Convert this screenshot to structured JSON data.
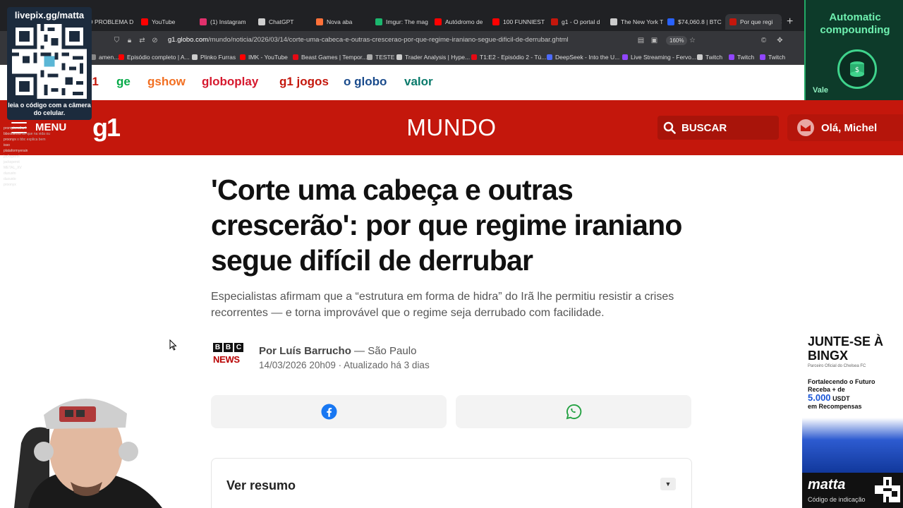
{
  "browser": {
    "tabs": [
      {
        "label": "O PROBLEMA D",
        "color": "#e53935"
      },
      {
        "label": "YouTube",
        "color": "#ff0000"
      },
      {
        "label": "(1) Instagram",
        "color": "#e1306c"
      },
      {
        "label": "ChatGPT",
        "color": "#cfcfcf"
      },
      {
        "label": "Nova aba",
        "color": "#ff7139"
      },
      {
        "label": "Imgur: The mag",
        "color": "#1bb76e"
      },
      {
        "label": "Autódromo de",
        "color": "#ff0000"
      },
      {
        "label": "100 FUNNIEST",
        "color": "#ff0000"
      },
      {
        "label": "g1 - O portal d",
        "color": "#c4170c"
      },
      {
        "label": "The New York T",
        "color": "#cccccc"
      },
      {
        "label": "$74,060.8 | BTC",
        "color": "#2962ff"
      },
      {
        "label": "Por que regi",
        "color": "#c4170c"
      }
    ],
    "url_host": "g1.globo.com",
    "url_path": "/mundo/noticia/2026/03/14/corte-uma-cabeca-e-outras-crescerao-por-que-regime-iraniano-segue-dificil-de-derrubar.ghtml",
    "zoom": "160%",
    "bookmarks": [
      {
        "label": "amen...",
        "color": "#888888"
      },
      {
        "label": "Episódio completo | A...",
        "color": "#ff0000"
      },
      {
        "label": "Plinko Furras",
        "color": "#cccccc"
      },
      {
        "label": "IMK - YouTube",
        "color": "#ff0000"
      },
      {
        "label": "Beast Games | Tempor...",
        "color": "#e50914"
      },
      {
        "label": "TESTE",
        "color": "#aaaaaa"
      },
      {
        "label": "Trader Analysis | Hype...",
        "color": "#cccccc"
      },
      {
        "label": "T1:E2 - Episódio 2 - Tú...",
        "color": "#e50914"
      },
      {
        "label": "DeepSeek - Into the U...",
        "color": "#4d6bfe"
      },
      {
        "label": "Live Streaming - Fervo...",
        "color": "#9146ff"
      },
      {
        "label": "Twitch",
        "color": "#cccccc"
      },
      {
        "label": "Twitch",
        "color": "#9146ff"
      },
      {
        "label": "Twitch",
        "color": "#9146ff"
      }
    ]
  },
  "globo_nav": [
    {
      "label": "g1",
      "color": "#c4170c"
    },
    {
      "label": "ge",
      "color": "#06aa48"
    },
    {
      "label": "gshow",
      "color": "#f26f21"
    },
    {
      "label": "globoplay",
      "color": "#d6192e"
    },
    {
      "label": "g1 jogos",
      "color": "#c4170c"
    },
    {
      "label": "o globo",
      "color": "#1a4b8c"
    },
    {
      "label": "valor",
      "color": "#0a7a6b"
    }
  ],
  "header": {
    "menu": "MENU",
    "logo": "g1",
    "section": "MUNDO",
    "search": "BUSCAR",
    "greeting": "Olá, Michel"
  },
  "article": {
    "headline": "'Corte uma cabeça e outras crescerão': por que regime iraniano segue difícil de derrubar",
    "subtitle": "Especialistas afirmam que a “estrutura em forma de hidra” do Irã lhe permitiu resistir a crises recorrentes — e torna improvável que o regime seja derrubado com facilidade.",
    "source_letters": [
      "B",
      "B",
      "C"
    ],
    "source_news": "NEWS",
    "author": "Por Luís Barrucho",
    "location": "— São Paulo",
    "date": "14/03/2026 20h09 · Atualizado há 3 dias",
    "resumo": "Ver resumo"
  },
  "overlays": {
    "qr_title": "livepix.gg/matta",
    "qr_caption": "leia o código com a câmera do celular.",
    "auto_title": "Automatic compounding",
    "auto_vale": "Vale",
    "bingx_title": "JUNTE-SE À BINGX",
    "bingx_sub": "Parceiro Oficial do Chelsea FC",
    "bingx_line1": "Fortalecendo o Futuro",
    "bingx_line2": "Receba + de",
    "bingx_amount": "5.000",
    "bingx_unit": "USDT",
    "bingx_line3": "em Recompensas",
    "bingx_name": "matta",
    "bingx_code": "Código de indicação",
    "chat": [
      {
        "user": "prompterstha4",
        "msg": ""
      },
      {
        "user": "bboobleoot",
        "msg": "do que na vida ou"
      },
      {
        "user": "proonyx",
        "msg": "o bbc explica bem"
      },
      {
        "user": "isso",
        "msg": ""
      },
      {
        "user": "plataformyerain",
        "msg": ""
      },
      {
        "user": "jacksperot",
        "msg": ""
      },
      {
        "user": "jacksperot",
        "msg": ""
      },
      {
        "user": "METAL_XV",
        "msg": ""
      },
      {
        "user": "duzusto",
        "msg": ""
      },
      {
        "user": "duzusto",
        "msg": ""
      },
      {
        "user": "proonyx",
        "msg": ""
      }
    ]
  }
}
